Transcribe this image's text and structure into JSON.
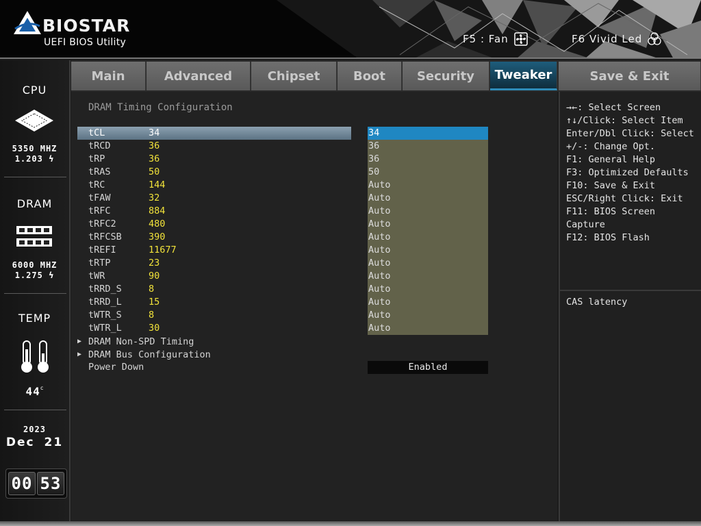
{
  "brand": {
    "name": "BIOSTAR",
    "subtitle": "UEFI BIOS Utility"
  },
  "hotkeys": [
    {
      "label": "F5 : Fan",
      "icon": "fan-icon"
    },
    {
      "label": "F6  Vivid Led",
      "icon": "led-icon"
    }
  ],
  "status": {
    "cpu": {
      "title": "CPU",
      "freq": "5350 MHZ",
      "voltage": "1.203",
      "icon": "cpu-chip-icon"
    },
    "dram": {
      "title": "DRAM",
      "freq": "6000 MHZ",
      "voltage": "1.275",
      "icon": "memory-module-icon"
    },
    "temp": {
      "title": "TEMP",
      "value": "44",
      "unit": "c",
      "icon": "thermometer-icon"
    },
    "date": {
      "year": "2023",
      "month": "Dec",
      "day": "21"
    },
    "time": {
      "hours": "00",
      "minutes": "53"
    }
  },
  "tabs": [
    {
      "label": "Main",
      "active": false
    },
    {
      "label": "Advanced",
      "active": false
    },
    {
      "label": "Chipset",
      "active": false
    },
    {
      "label": "Boot",
      "active": false
    },
    {
      "label": "Security",
      "active": false
    },
    {
      "label": "Tweaker",
      "active": true
    },
    {
      "label": "Save & Exit",
      "active": false
    }
  ],
  "section_title": "DRAM Timing Configuration",
  "timings": [
    {
      "name": "tCL",
      "current": "34",
      "setting": "34",
      "selected": true
    },
    {
      "name": "tRCD",
      "current": "36",
      "setting": "36"
    },
    {
      "name": "tRP",
      "current": "36",
      "setting": "36"
    },
    {
      "name": "tRAS",
      "current": "50",
      "setting": "50"
    },
    {
      "name": "tRC",
      "current": "144",
      "setting": "Auto"
    },
    {
      "name": "tFAW",
      "current": "32",
      "setting": "Auto"
    },
    {
      "name": "tRFC",
      "current": "884",
      "setting": "Auto"
    },
    {
      "name": "tRFC2",
      "current": "480",
      "setting": "Auto"
    },
    {
      "name": "tRFCSB",
      "current": "390",
      "setting": "Auto"
    },
    {
      "name": "tREFI",
      "current": "11677",
      "setting": "Auto"
    },
    {
      "name": "tRTP",
      "current": "23",
      "setting": "Auto"
    },
    {
      "name": "tWR",
      "current": "90",
      "setting": "Auto"
    },
    {
      "name": "tRRD_S",
      "current": "8",
      "setting": "Auto"
    },
    {
      "name": "tRRD_L",
      "current": "15",
      "setting": "Auto"
    },
    {
      "name": "tWTR_S",
      "current": "8",
      "setting": "Auto"
    },
    {
      "name": "tWTR_L",
      "current": "30",
      "setting": "Auto"
    }
  ],
  "submenus": [
    {
      "label": "DRAM Non-SPD Timing"
    },
    {
      "label": "DRAM Bus Configuration"
    }
  ],
  "power_down": {
    "label": "Power Down",
    "value": "Enabled"
  },
  "help": {
    "keys": [
      "→←: Select Screen",
      "↑↓/Click: Select Item",
      "Enter/Dbl Click: Select",
      "+/-: Change Opt.",
      "F1: General Help",
      "F3: Optimized Defaults",
      "F10: Save & Exit",
      "ESC/Right Click: Exit",
      "F11: BIOS Screen",
      "Capture",
      "F12: BIOS Flash"
    ],
    "description": "CAS latency"
  },
  "colors": {
    "accent": "#1f87c2",
    "current_value": "#f2e33a",
    "option_bg": "#62624a"
  }
}
